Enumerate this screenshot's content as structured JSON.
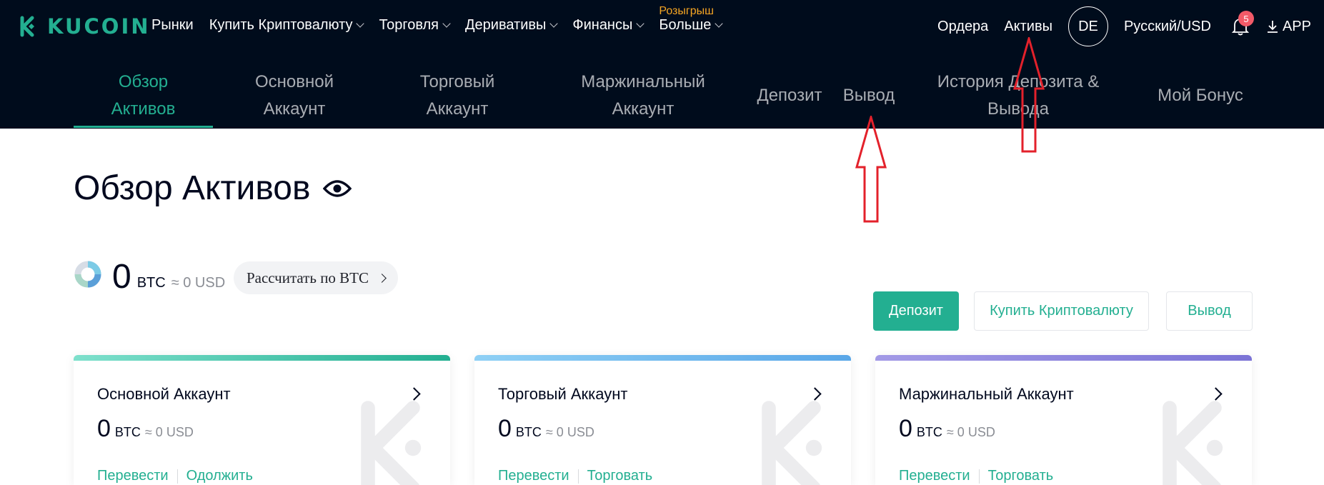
{
  "brand": {
    "name": "KUCOIN",
    "color": "#23af91"
  },
  "nav": {
    "items": [
      {
        "label": "Рынки",
        "has_chevron": false
      },
      {
        "label": "Купить Криптовалюту",
        "has_chevron": true
      },
      {
        "label": "Торговля",
        "has_chevron": true
      },
      {
        "label": "Деривативы",
        "has_chevron": true
      },
      {
        "label": "Финансы",
        "has_chevron": true
      },
      {
        "label": "Больше",
        "has_chevron": true
      }
    ],
    "promo_label": "Розыгрыш"
  },
  "right_nav": {
    "orders": "Ордера",
    "assets": "Активы",
    "avatar_initials": "DE",
    "language": "Русский/USD",
    "notification_count": "5",
    "app": "APP"
  },
  "subnav": {
    "tabs": [
      {
        "line1": "Обзор",
        "line2": "Активов",
        "active": true
      },
      {
        "line1": "Основной",
        "line2": "Аккаунт",
        "active": false
      },
      {
        "line1": "Торговый",
        "line2": "Аккаунт",
        "active": false
      },
      {
        "line1": "Маржинальный",
        "line2": "Аккаунт",
        "active": false
      },
      {
        "line1": "Депозит",
        "line2": "",
        "active": false
      },
      {
        "line1": "Вывод",
        "line2": "",
        "active": false
      },
      {
        "line1": "История Депозита &",
        "line2": "Вывода",
        "active": false
      },
      {
        "line1": "Мой Бонус",
        "line2": "",
        "active": false
      }
    ]
  },
  "page": {
    "title": "Обзор Активов",
    "total_value": "0",
    "total_unit": "BTC",
    "total_approx": "≈ 0 USD",
    "calc_label": "Рассчитать по BTC"
  },
  "actions": {
    "deposit": "Депозит",
    "buy_crypto": "Купить Криптовалюту",
    "withdraw": "Вывод"
  },
  "cards": [
    {
      "title": "Основной Аккаунт",
      "value": "0",
      "unit": "BTC",
      "approx": "≈ 0 USD",
      "link1": "Перевести",
      "link2": "Одолжить",
      "strip_color_1": "#7ee0cc",
      "strip_color_2": "#23af91"
    },
    {
      "title": "Торговый Аккаунт",
      "value": "0",
      "unit": "BTC",
      "approx": "≈ 0 USD",
      "link1": "Перевести",
      "link2": "Торговать",
      "strip_color_1": "#8fd0f5",
      "strip_color_2": "#5aa7e8"
    },
    {
      "title": "Маржинальный Аккаунт",
      "value": "0",
      "unit": "BTC",
      "approx": "≈ 0 USD",
      "link1": "Перевести",
      "link2": "Торговать",
      "strip_color_1": "#a39ae6",
      "strip_color_2": "#7b73d6"
    }
  ],
  "colors": {
    "accent": "#23af91",
    "nav_bg": "#000c1c",
    "promo": "#f5a623",
    "annotation_arrow": "#e3212b"
  }
}
